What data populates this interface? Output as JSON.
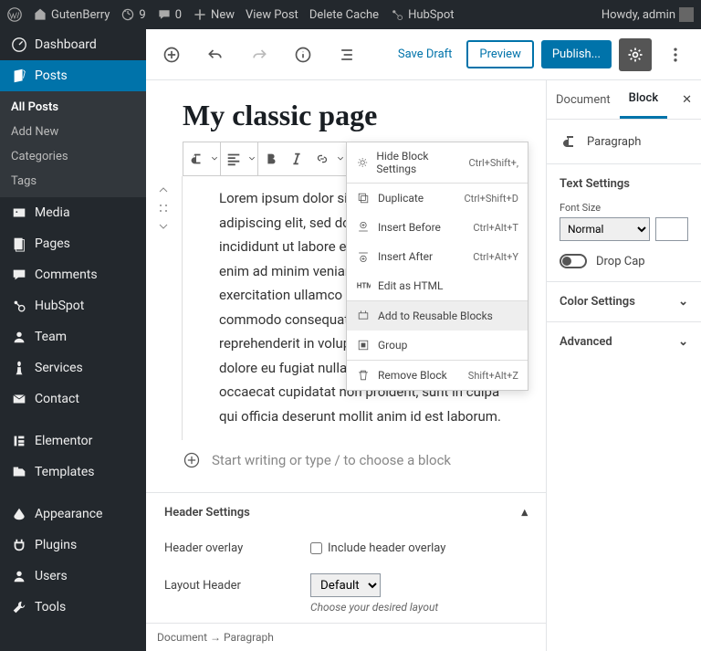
{
  "adminbar": {
    "site_name": "GutenBerry",
    "updates": "9",
    "comments": "0",
    "new": "New",
    "view_post": "View Post",
    "delete_cache": "Delete Cache",
    "hubspot": "HubSpot",
    "howdy": "Howdy, admin"
  },
  "sidebar": {
    "dashboard": "Dashboard",
    "posts": "Posts",
    "posts_sub": {
      "all": "All Posts",
      "add": "Add New",
      "cat": "Categories",
      "tags": "Tags"
    },
    "media": "Media",
    "pages": "Pages",
    "comments": "Comments",
    "hubspot": "HubSpot",
    "team": "Team",
    "services": "Services",
    "contact": "Contact",
    "elementor": "Elementor",
    "templates": "Templates",
    "appearance": "Appearance",
    "plugins": "Plugins",
    "users": "Users",
    "tools": "Tools"
  },
  "toolbar": {
    "save": "Save Draft",
    "preview": "Preview",
    "publish": "Publish..."
  },
  "post": {
    "title": "My classic page",
    "body": "Lorem ipsum dolor sit amet, consectetur adipiscing elit, sed do eiusmod tempor incididunt ut labore et dolore magna aliqua. Ut enim ad minim veniam, quis nostrud exercitation ullamco laboris nisi ut aliquip ex ea commodo consequat. Duis aute irure dolor in reprehenderit in voluptate velit esse cillum dolore eu fugiat nulla pariatur. Excepteur sint occaecat cupidatat non proident, sunt in culpa qui officia deserunt mollit anim id est laborum.",
    "appender": "Start writing or type / to choose a block"
  },
  "context_menu": {
    "hide": "Hide Block Settings",
    "hide_sc": "Ctrl+Shift+,",
    "dup": "Duplicate",
    "dup_sc": "Ctrl+Shift+D",
    "before": "Insert Before",
    "before_sc": "Ctrl+Alt+T",
    "after": "Insert After",
    "after_sc": "Ctrl+Alt+Y",
    "html": "Edit as HTML",
    "reusable": "Add to Reusable Blocks",
    "group": "Group",
    "remove": "Remove Block",
    "remove_sc": "Shift+Alt+Z"
  },
  "inspector": {
    "tab_doc": "Document",
    "tab_block": "Block",
    "block_type": "Paragraph",
    "text_settings": "Text Settings",
    "font_size": "Font Size",
    "font_size_val": "Normal",
    "dropcap": "Drop Cap",
    "color": "Color Settings",
    "advanced": "Advanced"
  },
  "metabox": {
    "header": "Header Settings",
    "overlay_label": "Header overlay",
    "overlay_check": "Include header overlay",
    "layout_label": "Layout Header",
    "layout_val": "Default",
    "layout_desc": "Choose your desired layout"
  },
  "breadcrumb": {
    "doc": "Document",
    "arrow": "→",
    "para": "Paragraph"
  }
}
